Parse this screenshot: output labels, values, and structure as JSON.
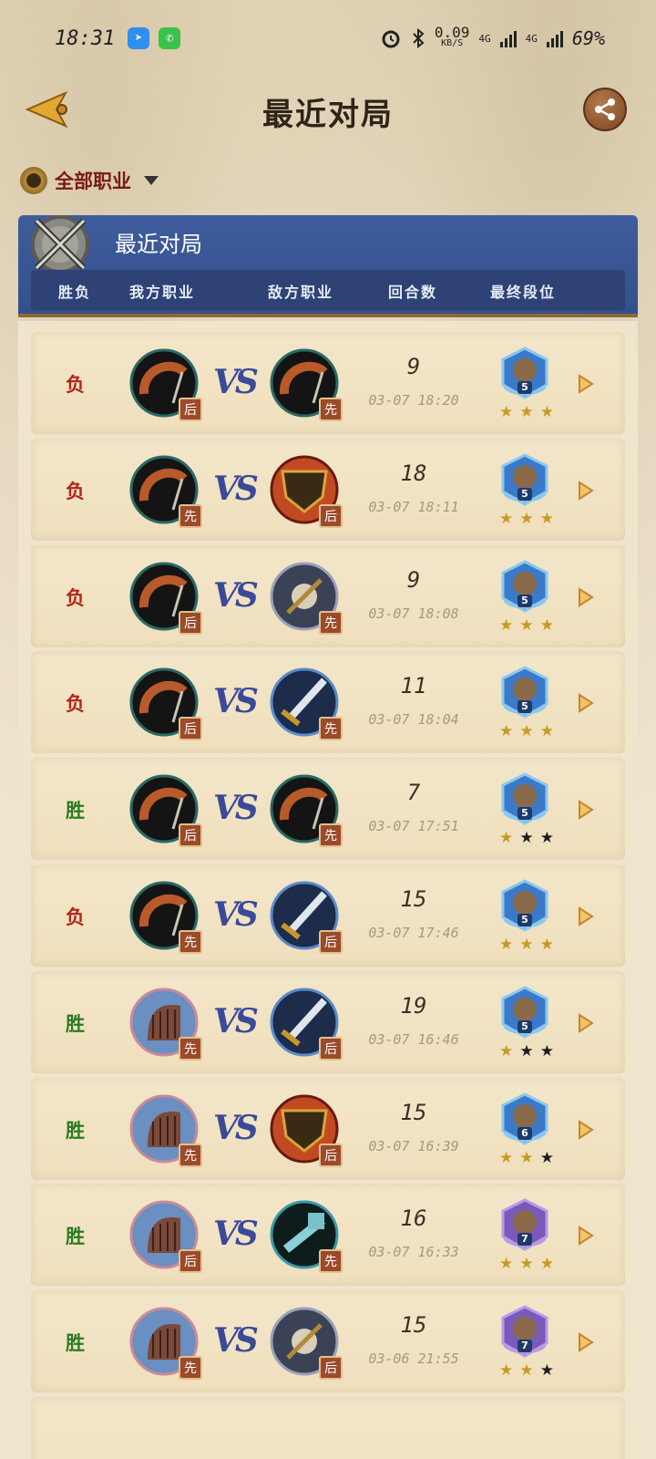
{
  "status_bar": {
    "time": "18:31",
    "network_speed": "0.09",
    "network_unit": "KB/S",
    "sim1": "4G",
    "sim2": "4G",
    "battery": "69%"
  },
  "header": {
    "title": "最近对局"
  },
  "filter": {
    "label": "全部职业"
  },
  "panel": {
    "title": "最近对局",
    "columns": [
      "胜负",
      "我方职业",
      "敌方职业",
      "回合数",
      "最终段位"
    ]
  },
  "matches": [
    {
      "result": "负",
      "win": false,
      "my_class": "rogue",
      "my_order": "后",
      "enemy_class": "rogue",
      "enemy_order": "先",
      "turns": "9",
      "datetime": "03-07 18:20",
      "rank": "5",
      "stars_filled": 3,
      "rank_color": "blue"
    },
    {
      "result": "负",
      "win": false,
      "my_class": "rogue",
      "my_order": "先",
      "enemy_class": "warlock",
      "enemy_order": "后",
      "turns": "18",
      "datetime": "03-07 18:11",
      "rank": "5",
      "stars_filled": 3,
      "rank_color": "blue"
    },
    {
      "result": "负",
      "win": false,
      "my_class": "rogue",
      "my_order": "后",
      "enemy_class": "deathknight",
      "enemy_order": "先",
      "turns": "9",
      "datetime": "03-07 18:08",
      "rank": "5",
      "stars_filled": 3,
      "rank_color": "blue"
    },
    {
      "result": "负",
      "win": false,
      "my_class": "rogue",
      "my_order": "后",
      "enemy_class": "warrior",
      "enemy_order": "先",
      "turns": "11",
      "datetime": "03-07 18:04",
      "rank": "5",
      "stars_filled": 3,
      "rank_color": "blue"
    },
    {
      "result": "胜",
      "win": true,
      "my_class": "rogue",
      "my_order": "后",
      "enemy_class": "rogue",
      "enemy_order": "先",
      "turns": "7",
      "datetime": "03-07 17:51",
      "rank": "5",
      "stars_filled": 1,
      "rank_color": "blue"
    },
    {
      "result": "负",
      "win": false,
      "my_class": "rogue",
      "my_order": "先",
      "enemy_class": "warrior",
      "enemy_order": "后",
      "turns": "15",
      "datetime": "03-07 17:46",
      "rank": "5",
      "stars_filled": 3,
      "rank_color": "blue"
    },
    {
      "result": "胜",
      "win": true,
      "my_class": "demonhunter",
      "my_order": "先",
      "enemy_class": "warrior",
      "enemy_order": "后",
      "turns": "19",
      "datetime": "03-07 16:46",
      "rank": "5",
      "stars_filled": 1,
      "rank_color": "blue"
    },
    {
      "result": "胜",
      "win": true,
      "my_class": "demonhunter",
      "my_order": "先",
      "enemy_class": "warlock",
      "enemy_order": "后",
      "turns": "15",
      "datetime": "03-07 16:39",
      "rank": "6",
      "stars_filled": 2,
      "rank_color": "blue"
    },
    {
      "result": "胜",
      "win": true,
      "my_class": "demonhunter",
      "my_order": "后",
      "enemy_class": "shaman",
      "enemy_order": "先",
      "turns": "16",
      "datetime": "03-07 16:33",
      "rank": "7",
      "stars_filled": 3,
      "rank_color": "purple"
    },
    {
      "result": "胜",
      "win": true,
      "my_class": "demonhunter",
      "my_order": "先",
      "enemy_class": "deathknight",
      "enemy_order": "后",
      "turns": "15",
      "datetime": "03-06 21:55",
      "rank": "7",
      "stars_filled": 2,
      "rank_color": "purple"
    }
  ],
  "class_colors": {
    "rogue": "#b85a2a",
    "warlock": "#c24a22",
    "deathknight": "#6a6f84",
    "warrior": "#4b6fa8",
    "demonhunter": "#5a7fae",
    "shaman": "#5aa0a8"
  },
  "icons": {
    "back": "arrow-left-icon",
    "share": "share-icon",
    "filter_emblem": "all-classes-emblem-icon",
    "dropdown": "caret-down-icon",
    "panel_emblem": "crossed-swords-icon",
    "detail": "chevron-right-icon"
  }
}
